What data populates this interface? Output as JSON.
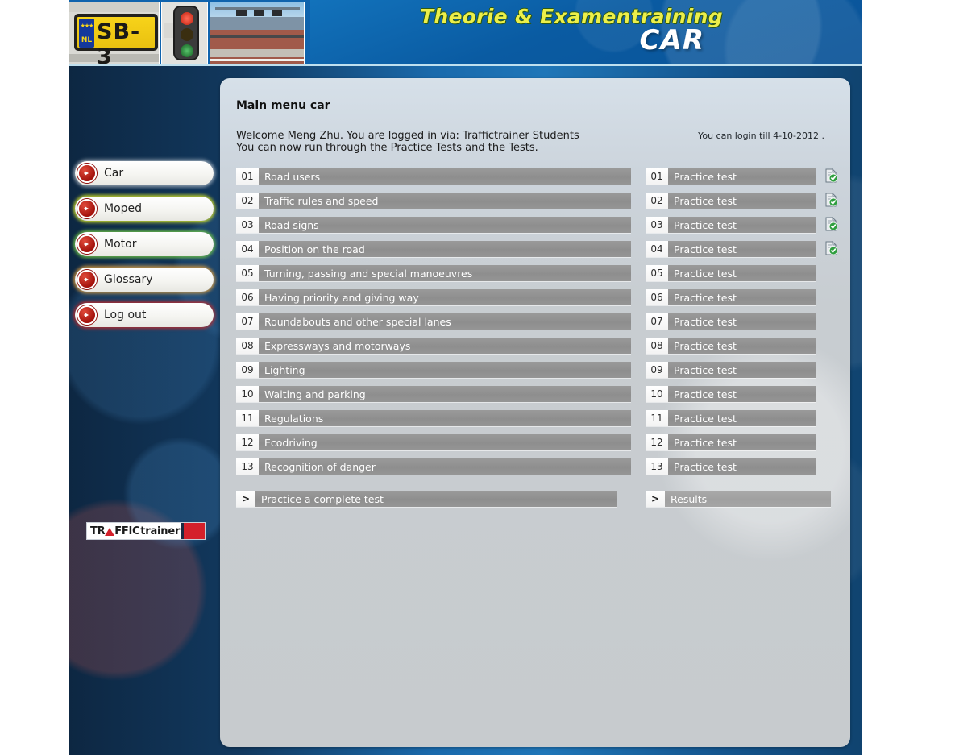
{
  "header": {
    "title_main": "Theorie & Examentraining",
    "title_sub": "CAR",
    "photo_plate_text": "SB-3",
    "photo_plate_country": "NL",
    "photo_plate_stars": "★★★",
    "photos": [
      "license-plate-photo",
      "traffic-light-photo",
      "highway-bridge-photo"
    ]
  },
  "sidebar": {
    "items": [
      {
        "label": "Car",
        "name": "sidebar-item-car"
      },
      {
        "label": "Moped",
        "name": "sidebar-item-moped"
      },
      {
        "label": "Motor",
        "name": "sidebar-item-motor"
      },
      {
        "label": "Glossary",
        "name": "sidebar-item-glossary"
      },
      {
        "label": "Log out",
        "name": "sidebar-item-logout"
      }
    ],
    "logo": {
      "part1": "TR",
      "part2": "FFIC",
      "part3": "trainer"
    }
  },
  "main": {
    "page_title": "Main menu car",
    "welcome_line1": "Welcome Meng Zhu. You are logged in via: Traffictrainer Students",
    "welcome_line2": "You can now run through the Practice Tests and the Tests.",
    "login_till": "You can login till 4-10-2012 .",
    "topics": [
      {
        "num": "01",
        "label": "Road users"
      },
      {
        "num": "02",
        "label": "Traffic rules and speed"
      },
      {
        "num": "03",
        "label": "Road signs"
      },
      {
        "num": "04",
        "label": "Position on the road"
      },
      {
        "num": "05",
        "label": "Turning, passing and special manoeuvres"
      },
      {
        "num": "06",
        "label": "Having priority and giving way"
      },
      {
        "num": "07",
        "label": "Roundabouts and other special lanes"
      },
      {
        "num": "08",
        "label": "Expressways and motorways"
      },
      {
        "num": "09",
        "label": "Lighting"
      },
      {
        "num": "10",
        "label": "Waiting and parking"
      },
      {
        "num": "11",
        "label": "Regulations"
      },
      {
        "num": "12",
        "label": "Ecodriving"
      },
      {
        "num": "13",
        "label": "Recognition of danger"
      }
    ],
    "tests": [
      {
        "num": "01",
        "label": "Practice test",
        "completed": true
      },
      {
        "num": "02",
        "label": "Practice test",
        "completed": true
      },
      {
        "num": "03",
        "label": "Practice test",
        "completed": true
      },
      {
        "num": "04",
        "label": "Practice test",
        "completed": true
      },
      {
        "num": "05",
        "label": "Practice test",
        "completed": false
      },
      {
        "num": "06",
        "label": "Practice test",
        "completed": false
      },
      {
        "num": "07",
        "label": "Practice test",
        "completed": false
      },
      {
        "num": "08",
        "label": "Practice test",
        "completed": false
      },
      {
        "num": "09",
        "label": "Practice test",
        "completed": false
      },
      {
        "num": "10",
        "label": "Practice test",
        "completed": false
      },
      {
        "num": "11",
        "label": "Practice test",
        "completed": false
      },
      {
        "num": "12",
        "label": "Practice test",
        "completed": false
      },
      {
        "num": "13",
        "label": "Practice test",
        "completed": false
      }
    ],
    "actions": {
      "complete_test": {
        "chevron": ">",
        "label": "Practice a complete test"
      },
      "results": {
        "chevron": ">",
        "label": "Results"
      }
    }
  },
  "colors": {
    "header_blue": "#0f63ad",
    "title_yellow": "#ecef4a",
    "bar_gray": "#949494",
    "panel_gray": "#c8cdd1",
    "accent_red": "#a3120c",
    "check_green": "#3aa53a"
  }
}
